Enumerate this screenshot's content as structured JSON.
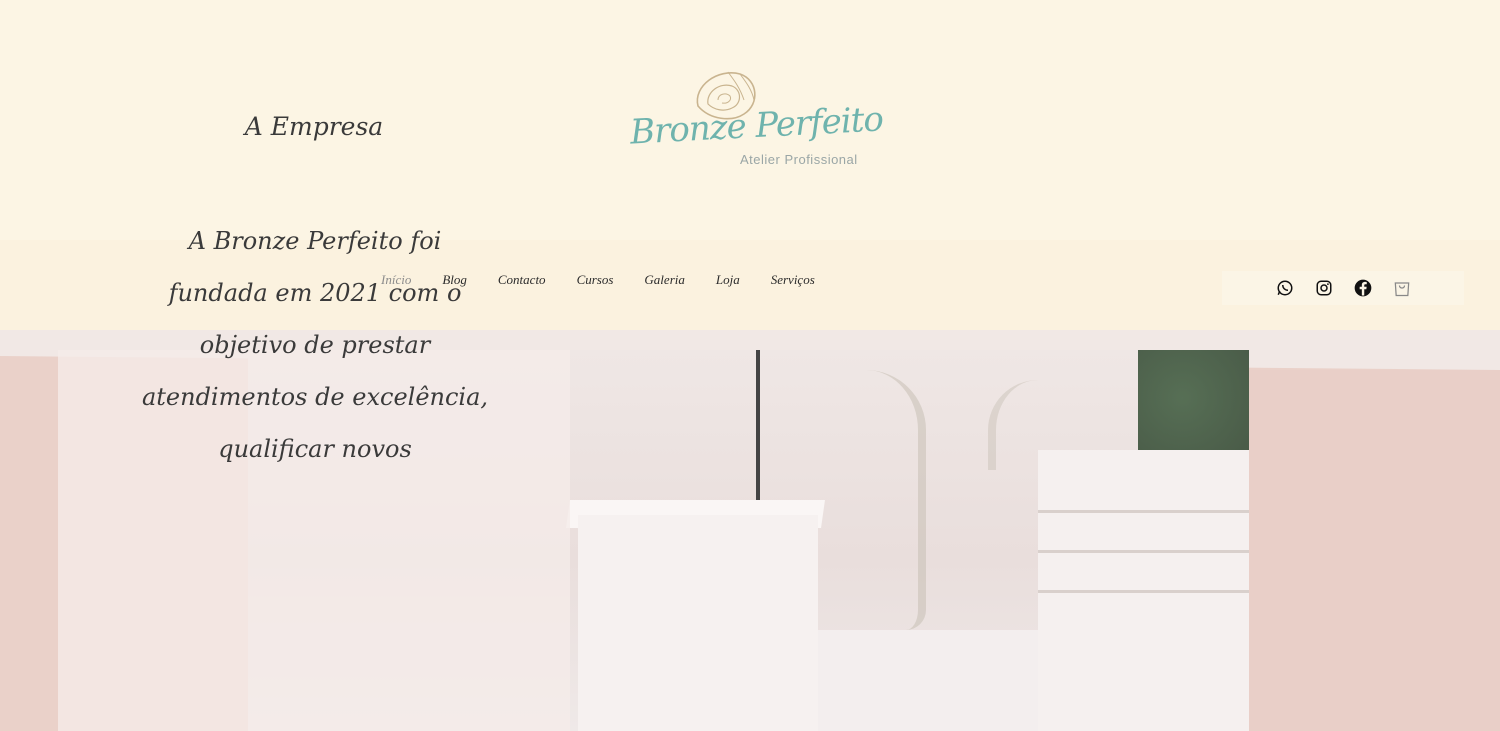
{
  "logo": {
    "script_text": "Bronze Perfeito",
    "subtitle": "Atelier Profissional",
    "icon": "shell-icon",
    "color": "#6fb3ad"
  },
  "nav": {
    "items": [
      {
        "label": "Início",
        "active": true
      },
      {
        "label": "Blog"
      },
      {
        "label": "Contacto"
      },
      {
        "label": "Cursos"
      },
      {
        "label": "Galeria"
      },
      {
        "label": "Loja"
      },
      {
        "label": "Serviços"
      }
    ]
  },
  "social": {
    "icons": [
      "whatsapp-icon",
      "instagram-icon",
      "facebook-icon",
      "shopping-bag-icon"
    ]
  },
  "hero": {
    "title": "A Empresa",
    "paragraph": "A Bronze Perfeito foi fundada em 2021 com o objetivo de prestar atendimentos de excelência, qualificar novos"
  },
  "colors": {
    "header_bg": "#fcf5e4",
    "hero_bg": "#ead1c9",
    "text": "#3a3a3a"
  }
}
